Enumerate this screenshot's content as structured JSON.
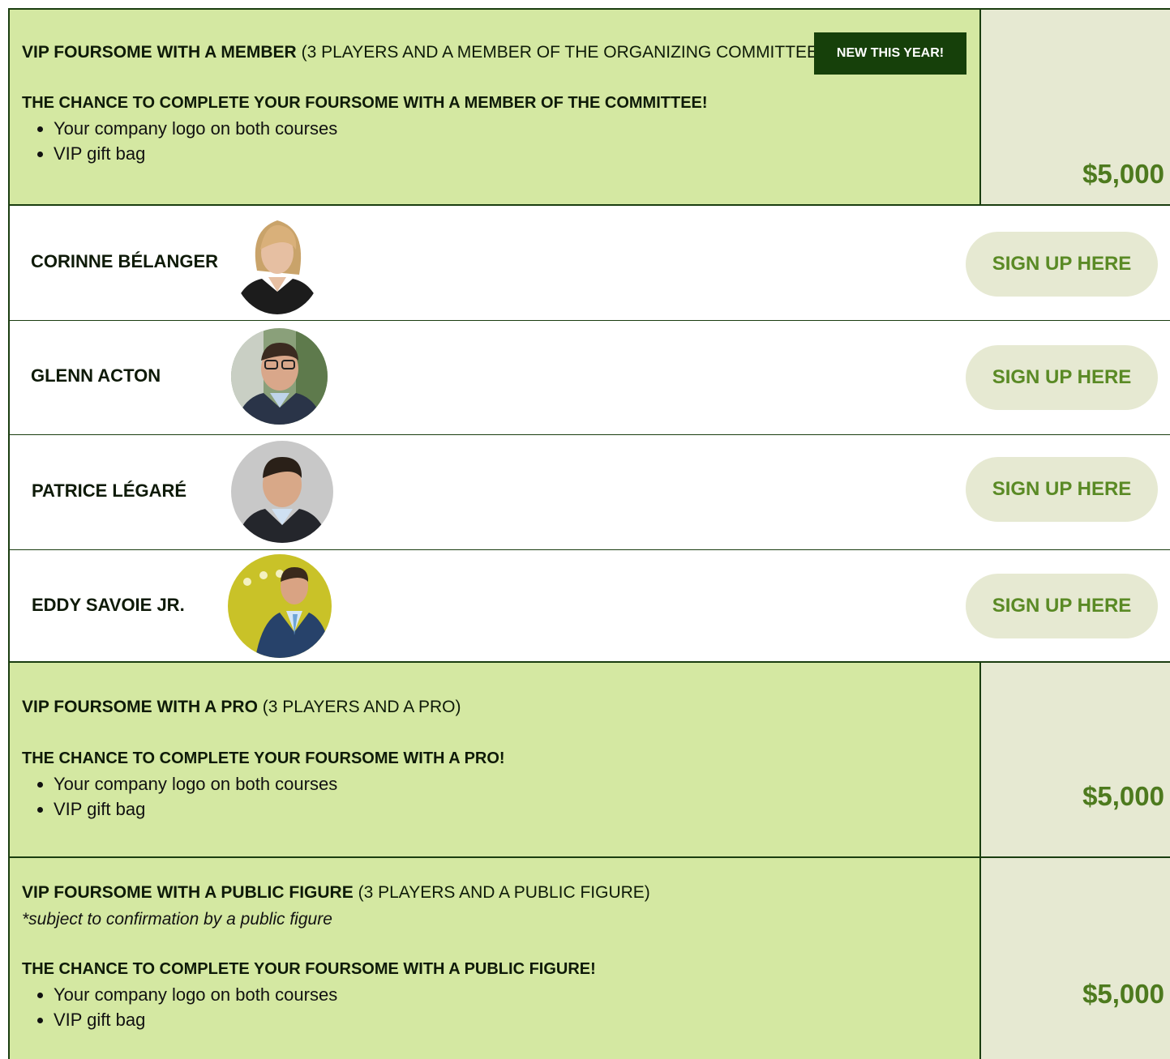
{
  "packages": [
    {
      "title": "VIP FOURSOME WITH A MEMBER",
      "title_suffix": "(3 PLAYERS AND A MEMBER OF THE ORGANIZING COMMITTEE)",
      "badge": "NEW THIS YEAR!",
      "subtitle": "THE CHANCE TO COMPLETE YOUR FOURSOME WITH A MEMBER OF THE COMMITTEE!",
      "perks": [
        "Your company logo on both courses",
        "VIP gift bag"
      ],
      "price": "$5,000"
    },
    {
      "title": "VIP FOURSOME WITH A PRO",
      "title_suffix": "(3 PLAYERS AND A PRO)",
      "subtitle": "THE CHANCE TO COMPLETE YOUR FOURSOME WITH A PRO!",
      "perks": [
        "Your company logo on both courses",
        "VIP gift bag"
      ],
      "price": "$5,000"
    },
    {
      "title": "VIP FOURSOME WITH A PUBLIC FIGURE",
      "title_suffix": "(3 PLAYERS AND A PUBLIC FIGURE)",
      "note": "*subject to confirmation by a public figure",
      "subtitle": "THE CHANCE TO COMPLETE YOUR FOURSOME WITH A PUBLIC FIGURE!",
      "perks": [
        "Your company logo on both courses",
        "VIP gift bag"
      ],
      "price": "$5,000"
    }
  ],
  "members": [
    {
      "name": "CORINNE BÉLANGER",
      "signup_label": "SIGN UP HERE"
    },
    {
      "name": "GLENN ACTON",
      "signup_label": "SIGN UP HERE"
    },
    {
      "name": "PATRICE LÉGARÉ",
      "signup_label": "SIGN UP HERE"
    },
    {
      "name": "EDDY SAVOIE JR.",
      "signup_label": "SIGN UP HERE"
    }
  ],
  "colors": {
    "package_bg": "#d4e8a2",
    "price_cell_bg": "#e6e9d2",
    "border": "#1a3d10",
    "badge_bg": "#16400a",
    "price_text": "#4d7a1e",
    "signup_text": "#5a8a25"
  }
}
